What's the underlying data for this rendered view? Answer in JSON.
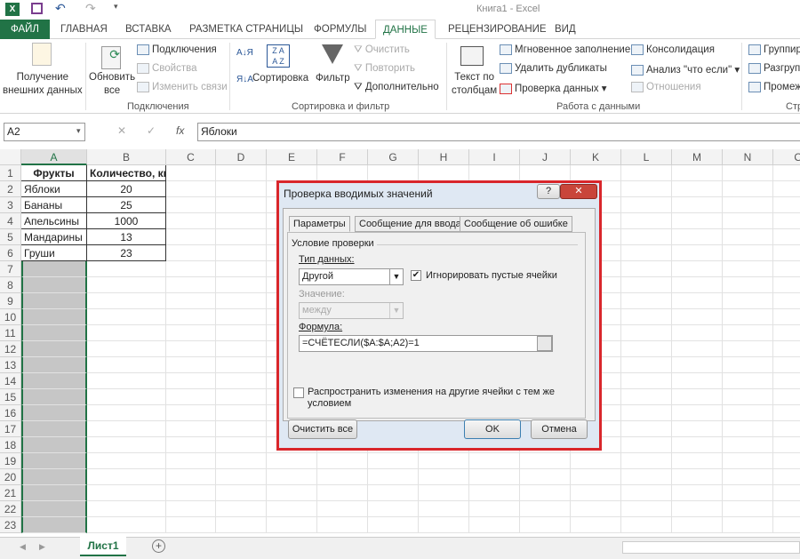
{
  "window": {
    "title": "Книга1 - Excel"
  },
  "tabs": [
    {
      "label": "ФАЙЛ"
    },
    {
      "label": "ГЛАВНАЯ"
    },
    {
      "label": "ВСТАВКА"
    },
    {
      "label": "РАЗМЕТКА СТРАНИЦЫ"
    },
    {
      "label": "ФОРМУЛЫ"
    },
    {
      "label": "ДАННЫЕ",
      "active": true
    },
    {
      "label": "РЕЦЕНЗИРОВАНИЕ"
    },
    {
      "label": "ВИД"
    }
  ],
  "ribbon": {
    "get_data": "Получение\nвнешних данных",
    "refresh": "Обновить\nвсе",
    "connections": "Подключения",
    "properties": "Свойства",
    "edit_links": "Изменить связи",
    "group_connections": "Подключения",
    "sort": "Сортировка",
    "filter": "Фильтр",
    "clear": "Очистить",
    "reapply": "Повторить",
    "advanced": "Дополнительно",
    "group_sort": "Сортировка и фильтр",
    "text_to_columns": "Текст по\nстолбцам",
    "flash_fill": "Мгновенное заполнение",
    "remove_duplicates": "Удалить дубликаты",
    "data_validation": "Проверка данных",
    "consolidate": "Консолидация",
    "what_if": "Анализ \"что если\"",
    "relationships": "Отношения",
    "group_data_tools": "Работа с данными",
    "group": "Группир",
    "ungroup": "Разгрупп",
    "subtotal": "Промеж",
    "group_outline": "Стр"
  },
  "formula_bar": {
    "name_box": "A2",
    "fx": "fx",
    "value": "Яблоки"
  },
  "columns": [
    "A",
    "B",
    "C",
    "D",
    "E",
    "F",
    "G",
    "H",
    "I",
    "J",
    "K",
    "L",
    "M",
    "N",
    "O"
  ],
  "table": {
    "headers": [
      "Фрукты",
      "Количество, кг"
    ],
    "rows": [
      [
        "Яблоки",
        "20"
      ],
      [
        "Бананы",
        "25"
      ],
      [
        "Апельсины",
        "1000"
      ],
      [
        "Мандарины",
        "13"
      ],
      [
        "Груши",
        "23"
      ]
    ]
  },
  "row_count": 23,
  "dialog": {
    "title": "Проверка вводимых значений",
    "help": "?",
    "close": "✕",
    "tabs": [
      "Параметры",
      "Сообщение для ввода",
      "Сообщение об ошибке"
    ],
    "section": "Условие проверки",
    "data_type_label": "Тип данных:",
    "data_type_value": "Другой",
    "ignore_blank": "Игнорировать пустые ячейки",
    "ignore_blank_checked": true,
    "value_label": "Значение:",
    "value_value": "между",
    "formula_label": "Формула:",
    "formula_value": "=СЧЁТЕСЛИ($A:$A;A2)=1",
    "apply_all": "Распространить изменения на другие ячейки с тем же условием",
    "apply_all_checked": false,
    "clear_all": "Очистить все",
    "ok": "OK",
    "cancel": "Отмена"
  },
  "sheets": [
    {
      "label": "Лист1"
    }
  ],
  "colors": {
    "accent": "#217346",
    "dialog_border": "#d9262b"
  }
}
